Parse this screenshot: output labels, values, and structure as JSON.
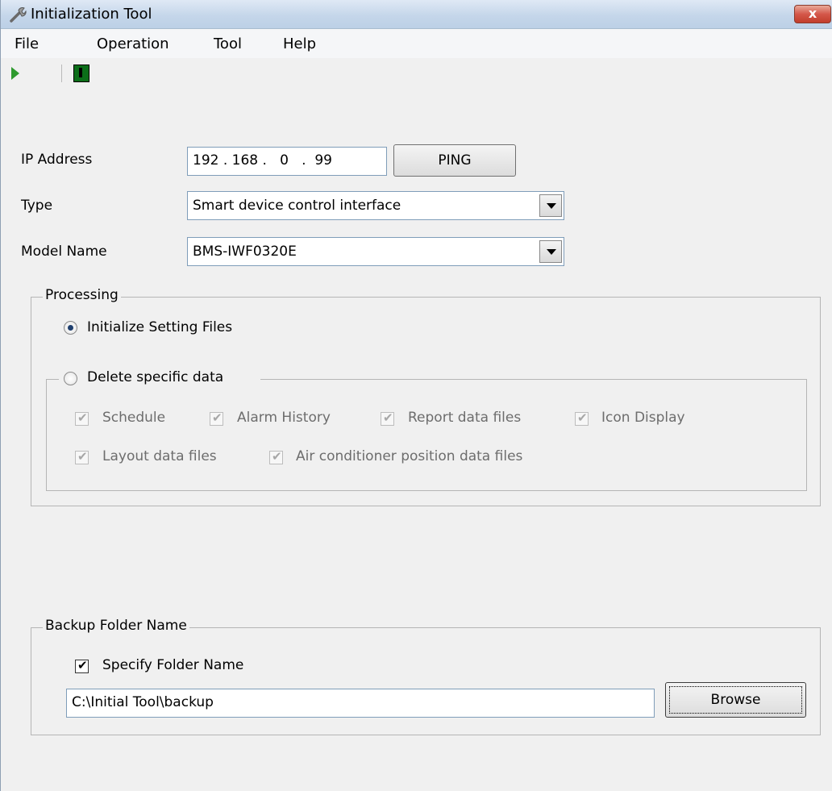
{
  "window": {
    "title": "Initialization Tool",
    "close_label": "x"
  },
  "menu": {
    "items": [
      "File",
      "Operation",
      "Tool",
      "Help"
    ]
  },
  "toolbar": {
    "icons": [
      "run-icon",
      "exit-icon"
    ]
  },
  "form": {
    "ip_label": "IP Address",
    "ip_value": "192 . 168 .   0   .  99",
    "ping_label": "PING",
    "type_label": "Type",
    "type_value": "Smart device control interface",
    "model_label": "Model Name",
    "model_value": "BMS-IWF0320E"
  },
  "processing": {
    "title": "Processing",
    "initialize_label": "Initialize Setting Files",
    "initialize_selected": true,
    "delete_label": "Delete specific data",
    "delete_selected": false,
    "delete_options": [
      {
        "label": "Schedule",
        "checked": true
      },
      {
        "label": "Alarm History",
        "checked": true
      },
      {
        "label": "Report data files",
        "checked": true
      },
      {
        "label": "Icon Display",
        "checked": true
      },
      {
        "label": "Layout data files",
        "checked": true
      },
      {
        "label": "Air conditioner position data files",
        "checked": true
      }
    ]
  },
  "backup": {
    "title": "Backup Folder Name",
    "specify_label": "Specify Folder Name",
    "specify_checked": true,
    "path_value": "C:\\Initial Tool\\backup",
    "browse_label": "Browse"
  }
}
